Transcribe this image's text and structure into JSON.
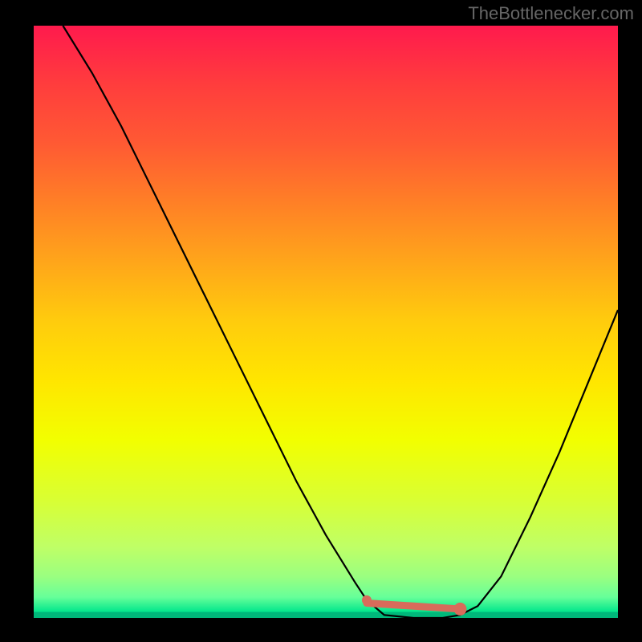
{
  "watermark": "TheBottlenecker.com",
  "chart_data": {
    "type": "line",
    "title": "",
    "xlabel": "",
    "ylabel": "",
    "xlim": [
      0,
      100
    ],
    "ylim": [
      0,
      100
    ],
    "series": [
      {
        "name": "curve",
        "x": [
          5,
          10,
          15,
          20,
          25,
          30,
          35,
          40,
          45,
          50,
          55,
          57,
          60,
          65,
          70,
          73,
          76,
          80,
          85,
          90,
          95,
          100
        ],
        "y": [
          100,
          92,
          83,
          73,
          63,
          53,
          43,
          33,
          23,
          14,
          6,
          3,
          0.5,
          0,
          0,
          0.5,
          2,
          7,
          17,
          28,
          40,
          52
        ]
      }
    ],
    "highlight": {
      "color": "#d86b5b",
      "segment_x": [
        57,
        73
      ],
      "segment_y": [
        2.5,
        1.5
      ],
      "dots": [
        {
          "x": 57,
          "y": 3,
          "r": 6
        },
        {
          "x": 73,
          "y": 1.5,
          "r": 8
        }
      ]
    },
    "green_band_y": 1
  }
}
